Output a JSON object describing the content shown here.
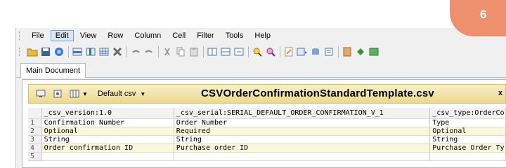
{
  "badge": {
    "number": "6",
    "color": "#ee8f6e"
  },
  "menu": [
    "File",
    "Edit",
    "View",
    "Row",
    "Column",
    "Cell",
    "Filter",
    "Tools",
    "Help"
  ],
  "active_menu": "Edit",
  "toolbar_icons": [
    "open-folder-icon",
    "save-icon",
    "print-icon",
    "insert-row-icon",
    "insert-column-icon",
    "table-icon",
    "delete-icon",
    "undo-icon",
    "redo-icon",
    "cut-icon",
    "copy-icon",
    "paste-icon",
    "split-icon",
    "merge-icon",
    "fit-icon",
    "find-icon",
    "find-next-icon",
    "edit-doc-icon",
    "export-icon",
    "db-icon",
    "list-icon",
    "notes-icon",
    "plugin-icon",
    "run-icon"
  ],
  "tab": {
    "label": "Main Document"
  },
  "doc_header": {
    "dropdown_label": "Default csv",
    "title": "CSVOrderConfirmationStandardTemplate.csv",
    "close": "x"
  },
  "colors": {
    "docbar": "#ecd98e",
    "alt_row": "#fbf7dc"
  },
  "table": {
    "header": [
      "_csv_version:1.0",
      "_csv_serial:SERIAL_DEFAULT_ORDER_CONFIRMATION_V_1",
      "_csv_type:OrderCo"
    ],
    "rows": [
      {
        "n": "1",
        "cells": [
          "Confirmation Number",
          "Order Number",
          "Type"
        ]
      },
      {
        "n": "2",
        "cells": [
          "Optional",
          "Required",
          "Optional"
        ]
      },
      {
        "n": "3",
        "cells": [
          "String",
          "String",
          "String"
        ]
      },
      {
        "n": "4",
        "cells": [
          "Order confirmation ID",
          "Purchase order ID",
          "Purchase Order Ty"
        ]
      },
      {
        "n": "5",
        "cells": [
          "",
          "",
          ""
        ]
      }
    ]
  }
}
